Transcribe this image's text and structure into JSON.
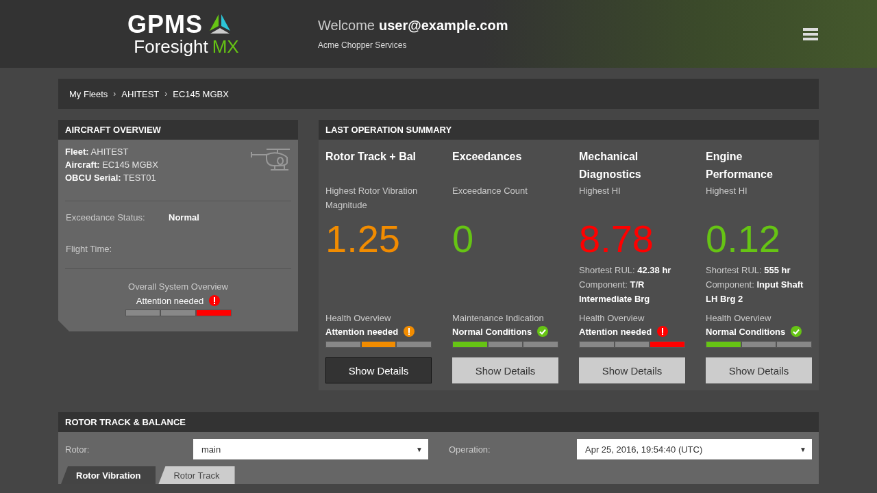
{
  "header": {
    "logo": {
      "brand": "GPMS",
      "product": "Foresight",
      "suffix": "MX"
    },
    "welcome": "Welcome",
    "user": "user@example.com",
    "company": "Acme Chopper Services"
  },
  "breadcrumb": {
    "separator": "›",
    "items": [
      "My Fleets",
      "AHITEST",
      "EC145 MGBX"
    ]
  },
  "aircraft_overview": {
    "title": "AIRCRAFT OVERVIEW",
    "fields": [
      {
        "label": "Fleet:",
        "value": "AHITEST"
      },
      {
        "label": "Aircraft:",
        "value": "EC145 MGBX"
      },
      {
        "label": "OBCU Serial:",
        "value": "TEST01"
      }
    ],
    "exceedance_label": "Exceedance Status:",
    "exceedance_value": "Normal",
    "flight_time_label": "Flight Time:",
    "overall": {
      "label": "Overall System Overview",
      "text": "Attention needed",
      "kind": "critical"
    }
  },
  "summary": {
    "title": "LAST OPERATION SUMMARY",
    "columns": [
      {
        "title": "Rotor Track + Bal",
        "metric_label": "Highest Rotor Vibration Magnitude",
        "value": "1.25",
        "kind": "warning",
        "health_label": "Health Overview",
        "health_text": "Attention needed",
        "button": "Show Details",
        "selected": true
      },
      {
        "title": "Exceedances",
        "metric_label": "Exceedance Count",
        "value": "0",
        "kind": "normal",
        "health_label": "Maintenance Indication",
        "health_text": "Normal Conditions",
        "button": "Show Details",
        "selected": false
      },
      {
        "title": "Mechanical Diagnostics",
        "metric_label": "Highest HI",
        "value": "8.78",
        "kind": "critical",
        "details": [
          {
            "label": "Shortest RUL:",
            "value": "42.38 hr"
          },
          {
            "label": "Component:",
            "value": "T/R Intermediate Brg"
          }
        ],
        "health_label": "Health Overview",
        "health_text": "Attention needed",
        "button": "Show Details",
        "selected": false
      },
      {
        "title": "Engine Performance",
        "metric_label": "Highest HI",
        "value": "0.12",
        "kind": "normal",
        "details": [
          {
            "label": "Shortest RUL:",
            "value": "555 hr"
          },
          {
            "label": "Component:",
            "value": "Input Shaft LH Brg 2"
          }
        ],
        "health_label": "Health Overview",
        "health_text": "Normal Conditions",
        "button": "Show Details",
        "selected": false
      }
    ]
  },
  "rotor_track": {
    "title": "ROTOR TRACK & BALANCE",
    "rotor_label": "Rotor:",
    "rotor_value": "main",
    "operation_label": "Operation:",
    "operation_value": "Apr 25, 2016, 19:54:40 (UTC)",
    "caret": "▼",
    "tabs": [
      {
        "label": "Rotor Vibration",
        "selected": true
      },
      {
        "label": "Rotor Track",
        "selected": false
      }
    ]
  }
}
